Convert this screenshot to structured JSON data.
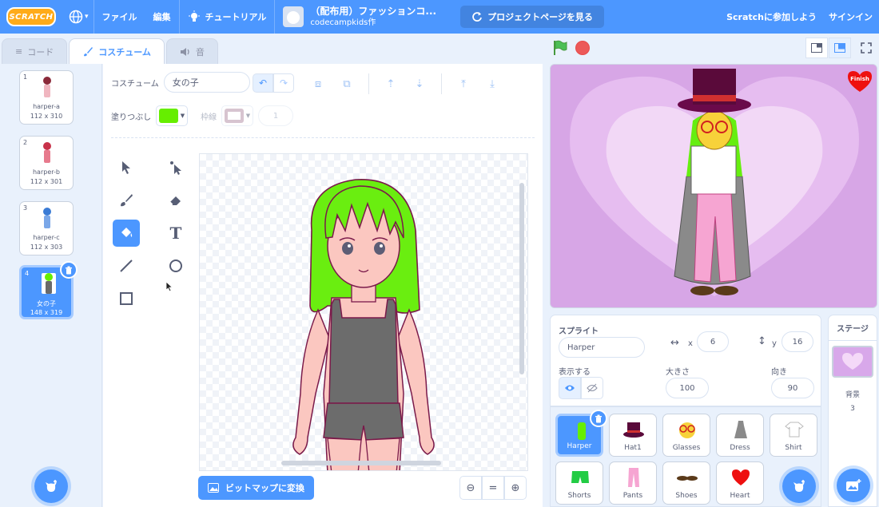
{
  "menubar": {
    "logo": "SCRATCH",
    "globe_caret": "▾",
    "file": "ファイル",
    "edit": "編集",
    "tutorials": "チュートリアル",
    "project_title": "（配布用）ファッションコ...",
    "project_author": "codecampkids作",
    "see_project": "プロジェクトページを見る",
    "join": "Scratchに参加しよう",
    "signin": "サインイン"
  },
  "tabs": {
    "code": "コード",
    "costumes": "コスチューム",
    "sounds": "音"
  },
  "costumes": [
    {
      "num": "1",
      "name": "harper-a",
      "size": "112 x 310"
    },
    {
      "num": "2",
      "name": "harper-b",
      "size": "112 x 301"
    },
    {
      "num": "3",
      "name": "harper-c",
      "size": "112 x 303"
    },
    {
      "num": "4",
      "name": "女の子",
      "size": "148 x 319"
    }
  ],
  "editor": {
    "costume_label": "コスチューム",
    "costume_name": "女の子",
    "fill_label": "塗りつぶし",
    "fill_color": "#66ee00",
    "outline_label": "枠線",
    "outline_color": "#b08ba2",
    "outline_width": "1",
    "convert_bitmap": "ビットマップに変換",
    "zoom_reset": "="
  },
  "stage": {
    "finish_label": "Finish"
  },
  "sprite_info": {
    "sprite_label": "スプライト",
    "sprite_name": "Harper",
    "x_label": "x",
    "x_value": "6",
    "y_label": "y",
    "y_value": "16",
    "show_label": "表示する",
    "size_label": "大きさ",
    "size_value": "100",
    "direction_label": "向き",
    "direction_value": "90"
  },
  "sprites": [
    {
      "name": "Harper"
    },
    {
      "name": "Hat1"
    },
    {
      "name": "Glasses"
    },
    {
      "name": "Dress"
    },
    {
      "name": "Shirt"
    },
    {
      "name": "Shorts"
    },
    {
      "name": "Pants"
    },
    {
      "name": "Shoes"
    },
    {
      "name": "Heart"
    }
  ],
  "stage_pane": {
    "title": "ステージ",
    "backdrop_label": "背景",
    "backdrop_count": "3"
  },
  "colors": {
    "accent": "#4c97ff",
    "menubar": "#4c97ff",
    "stage_bg": "#d6a6e6",
    "fill": "#66ee00"
  }
}
